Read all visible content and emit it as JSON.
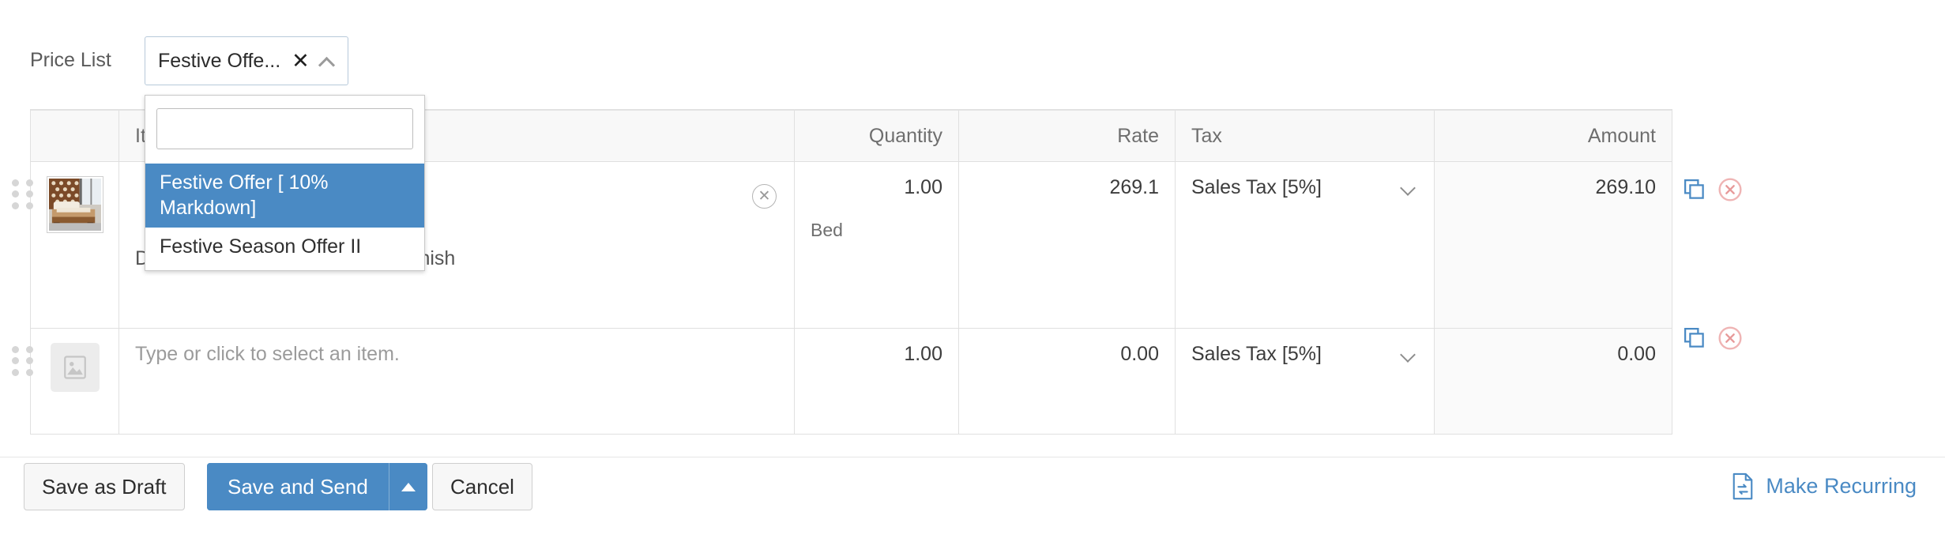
{
  "price_list": {
    "label": "Price List",
    "selected_chip": "Festive Offe...",
    "clear_glyph": "✕",
    "dropdown": {
      "search_value": "",
      "search_placeholder": "",
      "options": [
        {
          "label": "Festive Offer [ 10% Markdown]",
          "selected": true
        },
        {
          "label": "Festive Season Offer II",
          "selected": false
        }
      ]
    }
  },
  "items_table": {
    "headers": {
      "image": "",
      "item": "Item Deta",
      "quantity": "Quantity",
      "rate": "Rate",
      "tax": "Tax",
      "amount": "Amount"
    },
    "rows": [
      {
        "thumb": "bed-thumbnail",
        "item_name": "",
        "item_description": "Double Bed in Provincial Teak Finish",
        "quantity": "1.00",
        "unit": "Bed",
        "rate": "269.1",
        "tax": "Sales Tax [5%]",
        "amount": "269.10"
      },
      {
        "thumb": "image-placeholder",
        "item_name": "Type or click to select an item.",
        "item_description": "",
        "quantity": "1.00",
        "unit": "",
        "rate": "0.00",
        "tax": "Sales Tax [5%]",
        "amount": "0.00"
      }
    ]
  },
  "footer": {
    "save_as_draft": "Save as Draft",
    "save_and_send": "Save and Send",
    "cancel": "Cancel",
    "make_recurring": "Make Recurring"
  },
  "colors": {
    "accent_blue": "#4a8ac4",
    "remove_red": "#e8a0a0",
    "border_gray": "#e0e0e0",
    "header_bg": "#f8f8f8"
  }
}
